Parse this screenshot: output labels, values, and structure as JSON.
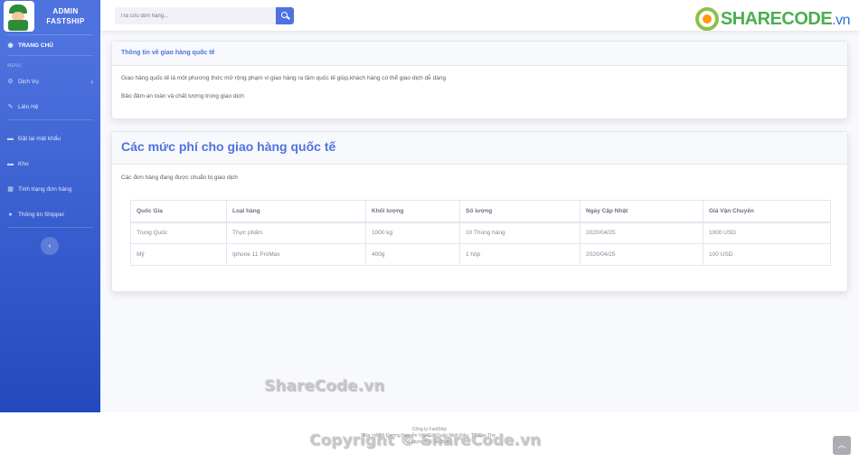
{
  "brand": {
    "line1": "ADMIN",
    "line2": "FASTSHIP"
  },
  "sidebar": {
    "dashboard": "TRANG CHỦ",
    "heading": "MENU",
    "items": [
      {
        "label": "Dịch Vụ",
        "icon": "gear-icon"
      },
      {
        "label": "Liên Hệ",
        "icon": "wrench-icon"
      },
      {
        "label": "Đặt lại mật khẩu",
        "icon": "folder-icon"
      },
      {
        "label": "Kho",
        "icon": "folder-icon"
      },
      {
        "label": "Tình trạng đơn hàng",
        "icon": "table-icon"
      },
      {
        "label": "Thông tin Shipper",
        "icon": "user-icon"
      }
    ],
    "toggle": "‹"
  },
  "search": {
    "placeholder": "Tra cứu đơn hàng..."
  },
  "logo": {
    "text": "SHARECODE",
    "suffix": ".vn"
  },
  "info_card": {
    "title": "Thông tin về giao hàng quốc tế",
    "line1": "Giao hàng quốc tế là một phương thức mở rộng phạm vi giao hàng ra tầm quốc tế giúp,khách hàng có thể giao dịch dễ dàng",
    "line2": "Bảo đảm an toàn và chất lượng trong giao dịch"
  },
  "fee_card": {
    "title": "Các mức phí cho giao hàng quốc tế",
    "subtitle": "Các đơn hàng đang được chuẩn bị giao dịch",
    "columns": [
      "Quốc Gia",
      "Loại hàng",
      "Khối lượng",
      "Số lượng",
      "Ngày Cập Nhật",
      "Giá Vận Chuyển"
    ],
    "rows": [
      [
        "Trung Quốc",
        "Thực phẩm",
        "1000 kg",
        "10 Thùng hàng",
        "2020/04/25",
        "1000 USD"
      ],
      [
        "Mỹ",
        "Iphone 11 ProMax",
        "400g",
        "1 hộp",
        "2020/04/25",
        "100 USD"
      ]
    ]
  },
  "footer": {
    "company": "Công ty FastShip",
    "address": "Địa chỉ: 56 Đường Nguyễn Văn Cừ, Quận Ninh Kiều, TP Cần Thơ",
    "copyright": "Copyright © FastShip"
  },
  "watermarks": [
    "ShareCode.vn",
    "Copyright © ShareCode.vn"
  ],
  "colors": {
    "primary": "#4e73df",
    "sidebar_bottom": "#224abe"
  }
}
